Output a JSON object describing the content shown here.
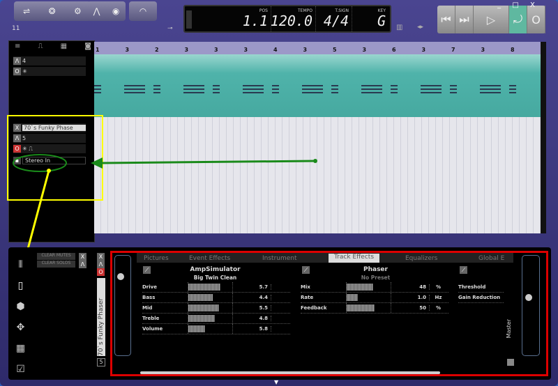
{
  "toolbar": {
    "counter": "11"
  },
  "display": {
    "pos_label": "POS",
    "pos": "1.1",
    "tempo_label": "TEMPO",
    "tempo": "120.0",
    "tsig_label": "T.SIGN",
    "tsig": "4/4",
    "key_label": "KEY",
    "key": "G"
  },
  "window": {
    "min": "_",
    "max": "□",
    "close": "X"
  },
  "ruler": [
    "1",
    "3",
    "2",
    "3",
    "3",
    "3",
    "4",
    "3",
    "5",
    "3",
    "6",
    "3",
    "7",
    "3",
    "8"
  ],
  "tracks": [
    {
      "number": "4"
    },
    {
      "name": "70`s Funky Phase",
      "number": "5",
      "input": "Stereo In"
    }
  ],
  "mixer": {
    "clear_mutes": "CLEAR MUTES",
    "clear_solos": "CLEAR SOLOS",
    "track_name": "70`s Funky Phaser",
    "track_number": "5",
    "master": "Master"
  },
  "tabs": [
    "Pictures",
    "Event Effects",
    "Instrument",
    "Track Effects",
    "Equalizers",
    "Global E"
  ],
  "effects": [
    {
      "name": "AmpSimulator",
      "preset": "Big Twin Clean",
      "params": [
        {
          "label": "Drive",
          "value": "5.7",
          "unit": "",
          "fill": 0.57
        },
        {
          "label": "Bass",
          "value": "4.4",
          "unit": "",
          "fill": 0.44
        },
        {
          "label": "Mid",
          "value": "5.5",
          "unit": "",
          "fill": 0.55
        },
        {
          "label": "Treble",
          "value": "4.8",
          "unit": "",
          "fill": 0.48
        },
        {
          "label": "Volume",
          "value": "5.8",
          "unit": "",
          "fill": 0.3
        }
      ]
    },
    {
      "name": "Phaser",
      "preset": "No Preset",
      "params": [
        {
          "label": "Mix",
          "value": "48",
          "unit": "%",
          "fill": 0.48
        },
        {
          "label": "Rate",
          "value": "1.0",
          "unit": "Hz",
          "fill": 0.2
        },
        {
          "label": "Feedback",
          "value": "50",
          "unit": "%",
          "fill": 0.5
        }
      ]
    },
    {
      "name": "",
      "preset": "",
      "params": [
        {
          "label": "Threshold"
        },
        {
          "label": "Gain Reduction"
        }
      ]
    }
  ]
}
